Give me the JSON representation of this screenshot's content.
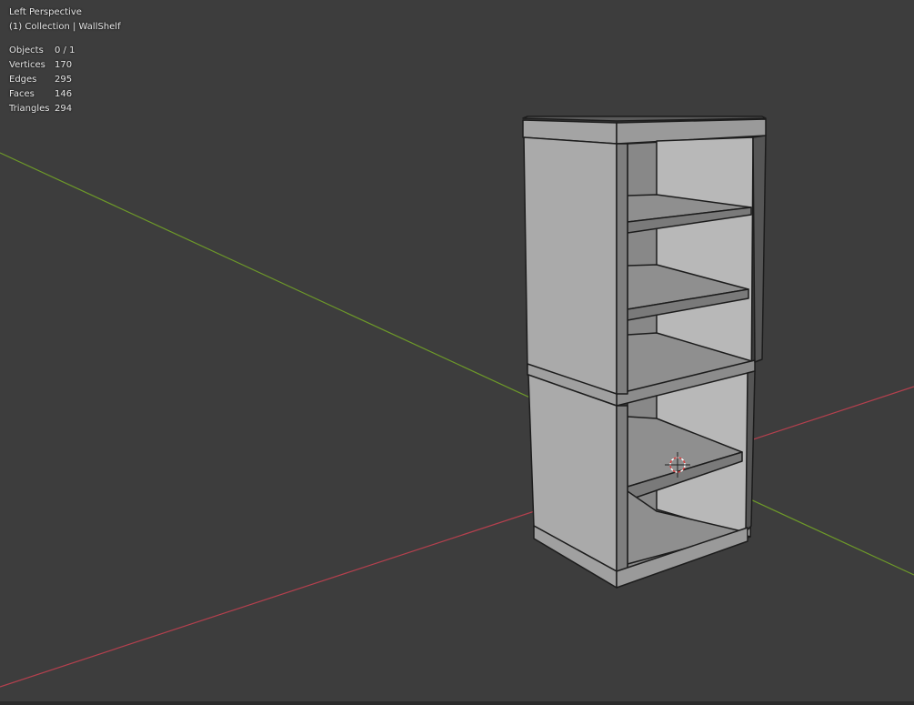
{
  "viewport": {
    "view_name": "Left Perspective",
    "collection_label": "(1) Collection | WallShelf"
  },
  "stats": [
    {
      "label": "Objects",
      "value": "0 / 1"
    },
    {
      "label": "Vertices",
      "value": "170"
    },
    {
      "label": "Edges",
      "value": "295"
    },
    {
      "label": "Faces",
      "value": "146"
    },
    {
      "label": "Triangles",
      "value": "294"
    }
  ],
  "colors": {
    "background": "#3d3d3d",
    "x_axis": "#b5404e",
    "y_axis": "#6e9a29",
    "shelf_front": "#a9a9a9",
    "shelf_interior": "#8a8a8a",
    "shelf_edge": "#1c1c1c",
    "cursor": "#d94040"
  },
  "icons": {
    "cursor": "3d-cursor-icon"
  }
}
